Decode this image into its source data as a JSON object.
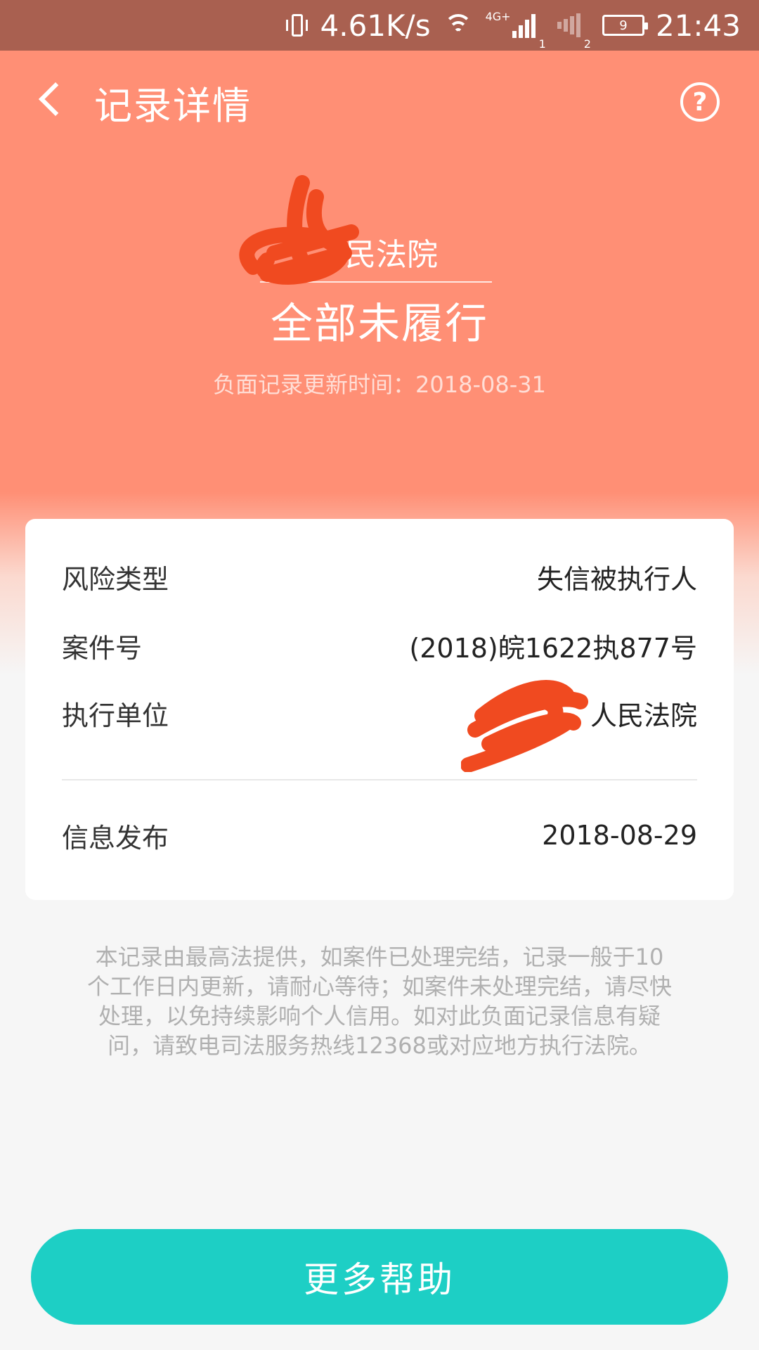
{
  "status_bar": {
    "net_speed": "4.61K/s",
    "network_tag": "4G+",
    "sim1": "1",
    "sim2": "2",
    "battery": "9",
    "time": "21:43"
  },
  "header": {
    "title": "记录详情"
  },
  "hero": {
    "court_name": "人民法院",
    "status": "全部未履行",
    "update_time": "负面记录更新时间：2018-08-31"
  },
  "details": [
    {
      "label": "风险类型",
      "value": "失信被执行人"
    },
    {
      "label": "案件号",
      "value": "(2018)皖1622执877号"
    },
    {
      "label": "执行单位",
      "value": "人民法院"
    },
    {
      "label": "信息发布",
      "value": "2018-08-29"
    }
  ],
  "notice": "本记录由最高法提供，如案件已处理完结，记录一般于10个工作日内更新，请耐心等待；如案件未处理完结，请尽快处理，以免持续影响个人信用。如对此负面记录信息有疑问，请致电司法服务热线12368或对应地方执行法院。",
  "footer": {
    "button_label": "更多帮助"
  },
  "colors": {
    "header_bg": "#ff8f75",
    "status_bar_bg": "#a96050",
    "button_bg": "#1dcfc5",
    "redaction": "#f04a20"
  }
}
